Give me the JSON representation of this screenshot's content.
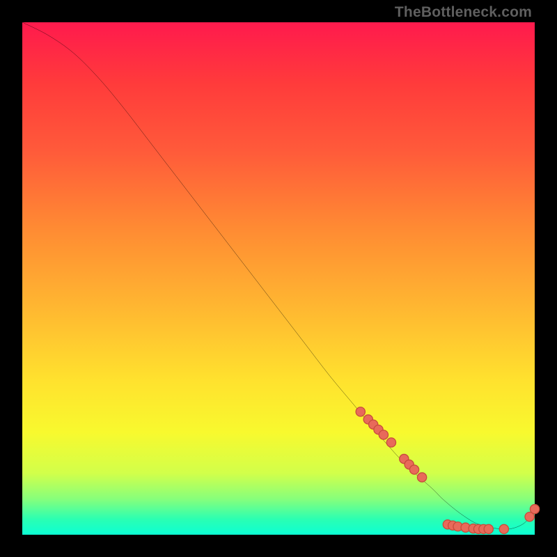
{
  "attribution": "TheBottleneck.com",
  "colors": {
    "black": "#000000",
    "curve": "#000000",
    "marker_fill": "#e86a5a",
    "marker_stroke": "#c74c3c"
  },
  "chart_data": {
    "type": "line",
    "title": "",
    "xlabel": "",
    "ylabel": "",
    "xlim": [
      0,
      100
    ],
    "ylim": [
      0,
      100
    ],
    "series": [
      {
        "name": "curve",
        "x": [
          0,
          5,
          10,
          15,
          20,
          25,
          30,
          35,
          40,
          45,
          50,
          55,
          60,
          65,
          70,
          75,
          80,
          82,
          85,
          88,
          90,
          92,
          95,
          98,
          100
        ],
        "y": [
          100,
          97.5,
          94,
          89,
          83,
          76.5,
          70,
          63.5,
          57,
          50.5,
          44,
          37.5,
          31,
          25,
          19,
          13.5,
          9,
          7,
          4.5,
          2.5,
          1.8,
          1.3,
          1.1,
          2.3,
          5
        ]
      }
    ],
    "markers": [
      {
        "x": 66,
        "y": 24.0
      },
      {
        "x": 67.5,
        "y": 22.5
      },
      {
        "x": 68.5,
        "y": 21.5
      },
      {
        "x": 69.5,
        "y": 20.5
      },
      {
        "x": 70.5,
        "y": 19.5
      },
      {
        "x": 72,
        "y": 18.0
      },
      {
        "x": 74.5,
        "y": 14.8
      },
      {
        "x": 75.5,
        "y": 13.7
      },
      {
        "x": 76.5,
        "y": 12.7
      },
      {
        "x": 78,
        "y": 11.2
      },
      {
        "x": 83,
        "y": 2.0
      },
      {
        "x": 84,
        "y": 1.8
      },
      {
        "x": 85,
        "y": 1.6
      },
      {
        "x": 86.5,
        "y": 1.4
      },
      {
        "x": 88,
        "y": 1.2
      },
      {
        "x": 89,
        "y": 1.1
      },
      {
        "x": 90,
        "y": 1.1
      },
      {
        "x": 91,
        "y": 1.1
      },
      {
        "x": 94,
        "y": 1.1
      },
      {
        "x": 99,
        "y": 3.5
      },
      {
        "x": 100,
        "y": 5.0
      }
    ]
  }
}
